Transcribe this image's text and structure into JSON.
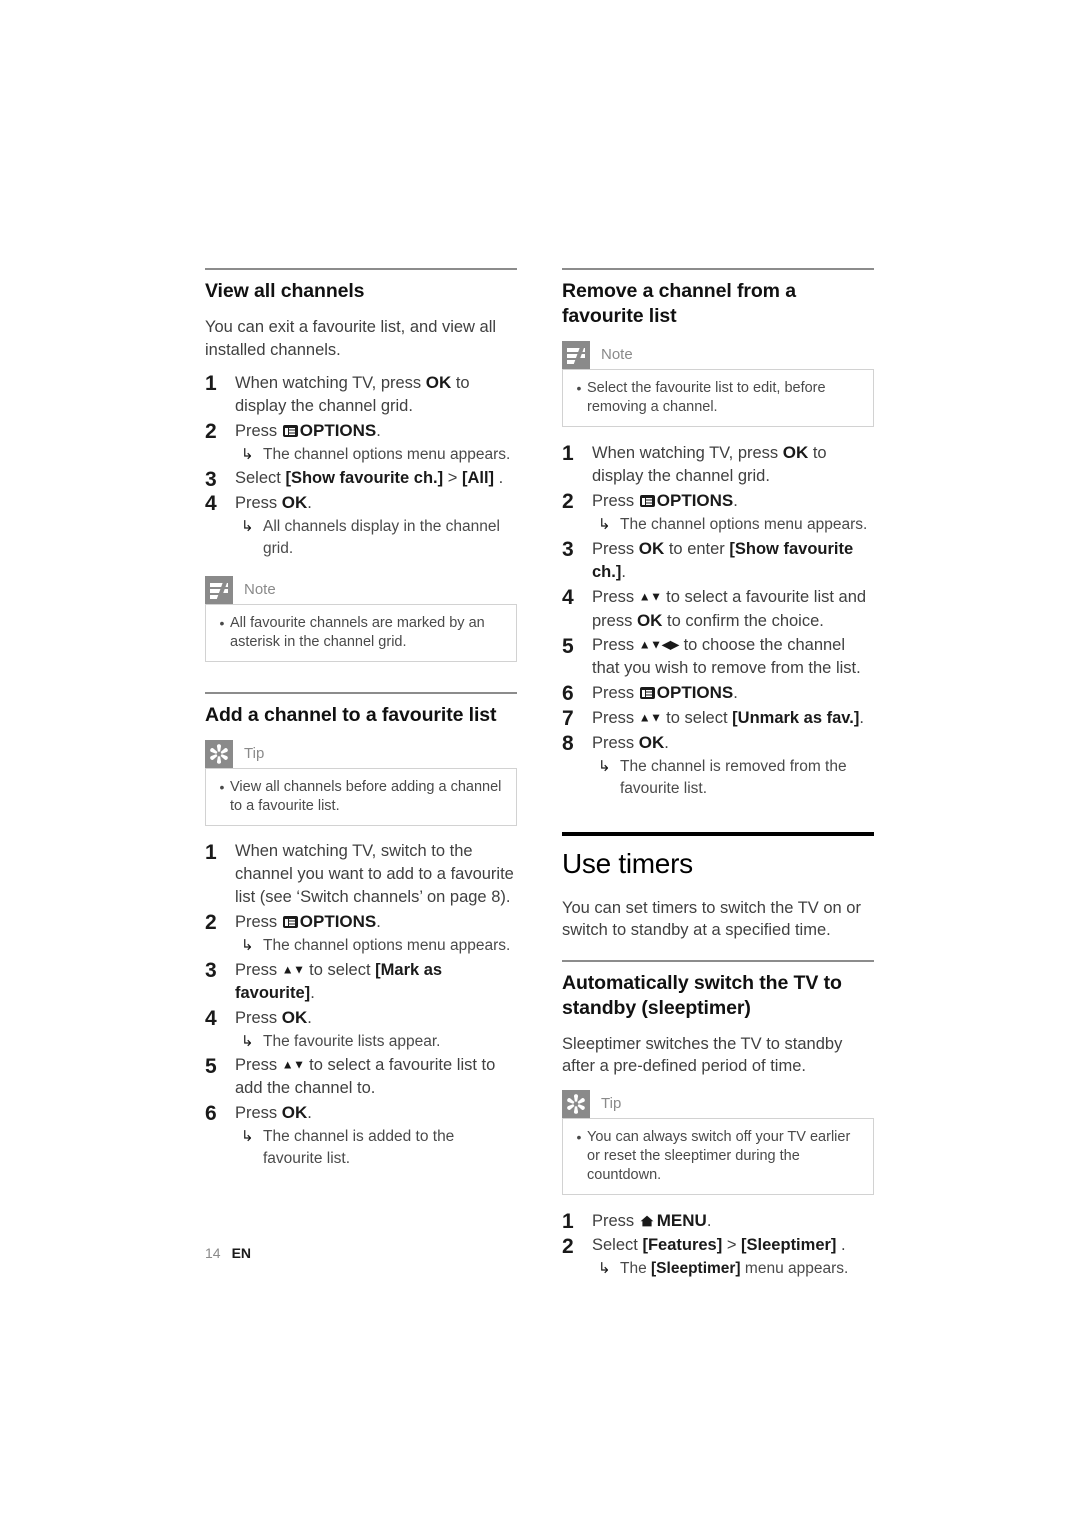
{
  "page": {
    "number": "14",
    "locale": "EN"
  },
  "left_column": {
    "section_view_all": {
      "title": "View all channels",
      "intro": "You can exit a favourite list, and view all installed channels.",
      "steps": [
        {
          "num": "1",
          "text_parts": [
            "When watching TV, press ",
            "OK",
            " to display the channel grid."
          ]
        },
        {
          "num": "2",
          "text_parts": [
            "Press ",
            "OPTIONS",
            "."
          ],
          "sub": "The channel options menu appears."
        },
        {
          "num": "3",
          "text_parts": [
            "Select ",
            "[Show favourite ch.]",
            " > ",
            "[All]",
            " ."
          ]
        },
        {
          "num": "4",
          "text_parts": [
            "Press ",
            "OK",
            "."
          ],
          "sub": "All channels display in the channel grid."
        }
      ],
      "note": {
        "label": "Note",
        "icon": "note-icon",
        "items": [
          "All favourite channels are marked by an asterisk in the channel grid."
        ]
      }
    },
    "section_add_channel": {
      "title": "Add a channel to a favourite list",
      "tip": {
        "label": "Tip",
        "icon": "tip-icon",
        "items": [
          "View all channels before adding a channel to a favourite list."
        ]
      },
      "steps": [
        {
          "num": "1",
          "text": "When watching TV, switch to the channel you want to add to a favourite list (see ‘Switch channels’ on page 8)."
        },
        {
          "num": "2",
          "text_parts": [
            "Press ",
            "OPTIONS",
            "."
          ],
          "sub": "The channel options menu appears."
        },
        {
          "num": "3",
          "text_parts": [
            "Press ",
            "▲▼",
            " to select ",
            "[Mark as favourite]",
            "."
          ]
        },
        {
          "num": "4",
          "text_parts": [
            "Press ",
            "OK",
            "."
          ],
          "sub": "The favourite lists appear."
        },
        {
          "num": "5",
          "text_parts": [
            "Press ",
            "▲▼",
            " to select a favourite list to add the channel to."
          ]
        },
        {
          "num": "6",
          "text_parts": [
            "Press ",
            "OK",
            "."
          ],
          "sub": "The channel is added to the favourite list."
        }
      ]
    }
  },
  "right_column": {
    "section_remove_channel": {
      "title": "Remove a channel from a favourite list",
      "note": {
        "label": "Note",
        "icon": "note-icon",
        "items": [
          "Select the favourite list to edit, before removing a channel."
        ]
      },
      "steps": [
        {
          "num": "1",
          "text_parts": [
            "When watching TV, press ",
            "OK",
            " to display the channel grid."
          ]
        },
        {
          "num": "2",
          "text_parts": [
            "Press ",
            "OPTIONS",
            "."
          ],
          "sub": "The channel options menu appears."
        },
        {
          "num": "3",
          "text_parts": [
            "Press ",
            "OK",
            " to enter ",
            "[Show favourite ch.]",
            "."
          ]
        },
        {
          "num": "4",
          "text_parts": [
            "Press ",
            "▲▼",
            " to select a favourite list and press ",
            "OK",
            " to confirm the choice."
          ]
        },
        {
          "num": "5",
          "text_parts": [
            "Press ",
            "▲▼◀▶",
            " to choose the channel that you wish to remove from the list."
          ]
        },
        {
          "num": "6",
          "text_parts": [
            "Press ",
            "OPTIONS",
            "."
          ]
        },
        {
          "num": "7",
          "text_parts": [
            "Press ",
            "▲▼",
            " to select ",
            "[Unmark as fav.]",
            "."
          ]
        },
        {
          "num": "8",
          "text_parts": [
            "Press ",
            "OK",
            "."
          ],
          "sub": "The channel is removed from the favourite list."
        }
      ]
    },
    "section_use_timers": {
      "title": "Use timers",
      "intro": "You can set timers to switch the TV on or switch to standby at a specified time.",
      "subsection": {
        "title": "Automatically switch the TV to standby (sleeptimer)",
        "intro": "Sleeptimer switches the TV to standby after a pre-defined period of time.",
        "tip": {
          "label": "Tip",
          "icon": "tip-icon",
          "items": [
            "You can always switch off your TV earlier or reset the sleeptimer during the countdown."
          ]
        },
        "steps": [
          {
            "num": "1",
            "text_parts": [
              "Press ",
              "MENU",
              "."
            ]
          },
          {
            "num": "2",
            "text_parts": [
              "Select ",
              "[Features]",
              " > ",
              "[Sleeptimer]",
              " ."
            ],
            "sub_parts": [
              "The ",
              "[Sleeptimer]",
              " menu appears."
            ]
          }
        ]
      }
    }
  },
  "glyphs": {
    "options_icon": "options-icon",
    "home_icon": "home-menu-icon",
    "substep_arrow": "↳",
    "bullet": "•"
  },
  "colors": {
    "rule_gray": "#8c8c8c",
    "rule_black": "#000000",
    "badge_gray": "#8a8a8a",
    "body_text": "#404040",
    "box_border": "#d2d2d2"
  }
}
